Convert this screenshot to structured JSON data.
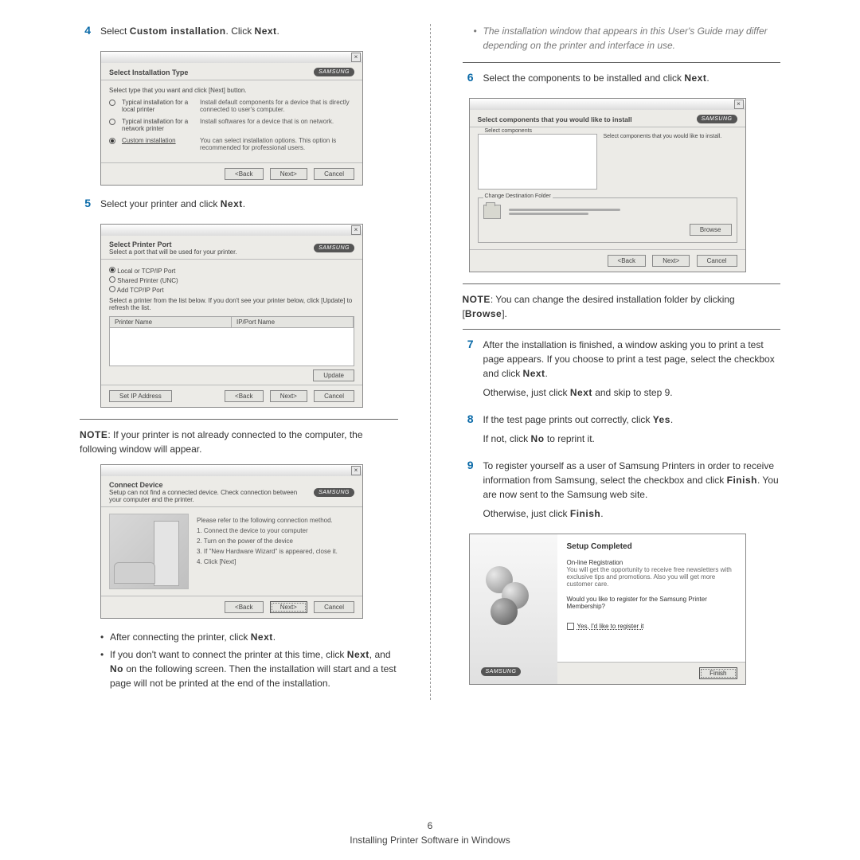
{
  "page_number": "6",
  "footer_title": "Installing Printer Software in Windows",
  "left": {
    "step4": {
      "num": "4",
      "text_pre": "Select ",
      "bold": "Custom installation",
      "text_post": ". Click ",
      "bold2": "Next",
      "post2": "."
    },
    "dlg1": {
      "title": "Select Installation Type",
      "brand": "SAMSUNG",
      "instr": "Select type that you want and click [Next] button.",
      "opt1_label": "Typical installation for a local printer",
      "opt1_desc": "Install default components for a device that is directly connected to user's computer.",
      "opt2_label": "Typical installation for a network printer",
      "opt2_desc": "Install softwares for a device that is on network.",
      "opt3_label": "Custom installation",
      "opt3_desc": "You can select installation options. This option is recommended for professional users.",
      "back": "<Back",
      "next": "Next>",
      "cancel": "Cancel"
    },
    "step5": {
      "num": "5",
      "text_pre": "Select your printer and click ",
      "bold": "Next",
      "post": "."
    },
    "dlg2": {
      "title": "Select Printer Port",
      "sub": "Select a port that will be used for your printer.",
      "brand": "SAMSUNG",
      "p1": "Local or TCP/IP Port",
      "p2": "Shared Printer (UNC)",
      "p3": "Add TCP/IP Port",
      "instr": "Select a printer from the list below. If you don't see your printer below, click [Update] to refresh the list.",
      "col1": "Printer Name",
      "col2": "IP/Port Name",
      "update": "Update",
      "setip": "Set IP Address",
      "back": "<Back",
      "next": "Next>",
      "cancel": "Cancel"
    },
    "note1_label": "NOTE",
    "note1": ": If your printer is not already connected to the computer, the following window will appear.",
    "dlg3": {
      "title": "Connect Device",
      "sub": "Setup can not find a connected device. Check connection between your computer and the printer.",
      "brand": "SAMSUNG",
      "s0": "Please refer to the following connection method.",
      "s1": "1. Connect the device to your computer",
      "s2": "2. Turn on the power of the device",
      "s3": "3. If \"New Hardware Wizard\" is appeared, close it.",
      "s4": "4. Click [Next]",
      "back": "<Back",
      "next": "Next>",
      "cancel": "Cancel"
    },
    "bullet1_pre": "After connecting the printer, click ",
    "bullet1_bold": "Next",
    "bullet1_post": ".",
    "bullet2_a": "If you don't want to connect the printer at this time, click ",
    "bullet2_b": "Next",
    "bullet2_c": ", and ",
    "bullet2_d": "No",
    "bullet2_e": " on the following screen. Then the installation will start and a test page will not be printed at the end of the installation."
  },
  "right": {
    "italic_note": "The installation window that appears in this User's Guide may differ depending on the printer and interface in use.",
    "step6": {
      "num": "6",
      "pre": "Select the components to be installed and click ",
      "bold": "Next",
      "post": "."
    },
    "dlg4": {
      "title": "Select components that you would like to install",
      "brand": "SAMSUNG",
      "boxlabel": "Select components",
      "right_hint": "Select components that you would like to install.",
      "destlabel": "Change Destination Folder",
      "browse": "Browse",
      "back": "<Back",
      "next": "Next>",
      "cancel": "Cancel"
    },
    "note2_label": "NOTE",
    "note2_a": ": You can change the desired installation folder by clicking [",
    "note2_b": "Browse",
    "note2_c": "].",
    "step7": {
      "num": "7",
      "line1a": "After the installation is finished, a window asking you to print a test page appears. If you choose to print a test page, select the checkbox and click ",
      "line1b": "Next",
      "line1c": ".",
      "line2a": "Otherwise, just click ",
      "line2b": "Next",
      "line2c": " and skip to step 9."
    },
    "step8": {
      "num": "8",
      "l1a": "If the test page prints out correctly, click ",
      "l1b": "Yes",
      "l1c": ".",
      "l2a": "If not, click ",
      "l2b": "No",
      "l2c": " to reprint it."
    },
    "step9": {
      "num": "9",
      "l1a": "To register yourself as a user of Samsung Printers in order to receive information from Samsung, select the checkbox and click ",
      "l1b": "Finish",
      "l1c": ". You are now sent to the Samsung web site.",
      "l2a": "Otherwise, just click ",
      "l2b": "Finish",
      "l2c": "."
    },
    "dlg5": {
      "title": "Setup Completed",
      "reg_h": "On-line Registration",
      "reg_t": "You will get the opportunity to receive free newsletters with exclusive tips and promotions. Also you will get more customer care.",
      "q": "Would you like to register for the Samsung Printer Membership?",
      "chk": "Yes, I'd like to register it",
      "brand": "SAMSUNG",
      "finish": "Finish"
    }
  }
}
